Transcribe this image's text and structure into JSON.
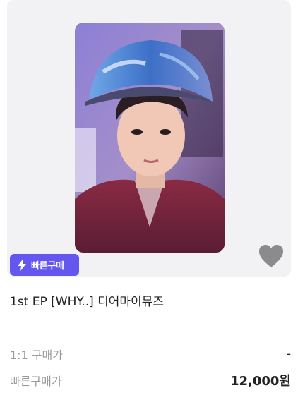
{
  "badge": {
    "label": "빠른구매",
    "icon": "lightning-icon",
    "color": "#6457f0"
  },
  "product": {
    "title": "1st EP [WHY..] 디어마이뮤즈",
    "image_icon": "photocard-image",
    "favorite_icon": "heart-icon"
  },
  "prices": [
    {
      "label": "1:1 구매가",
      "value": "-"
    },
    {
      "label": "빠른구매가",
      "value": "12,000원"
    }
  ]
}
